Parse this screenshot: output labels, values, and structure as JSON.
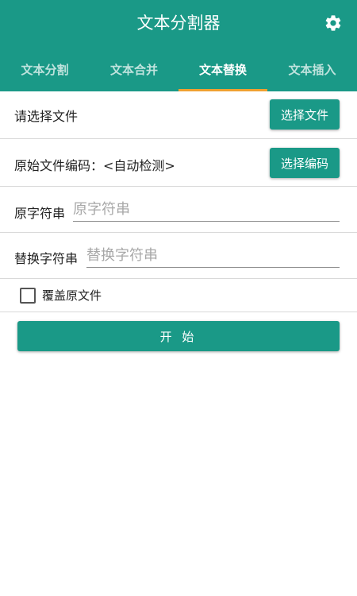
{
  "app": {
    "title": "文本分割器",
    "accent": "#1a9987",
    "tab_indicator": "#f0a030"
  },
  "header": {
    "settings_icon": "gear-icon"
  },
  "tabs": [
    {
      "label": "文本分割"
    },
    {
      "label": "文本合并"
    },
    {
      "label": "文本替换",
      "active": true
    },
    {
      "label": "文本插入"
    }
  ],
  "file_row": {
    "label": "请选择文件",
    "button": "选择文件"
  },
  "encoding_row": {
    "label": "原始文件编码：<自动检测>",
    "button": "选择编码"
  },
  "source_row": {
    "label": "原字符串",
    "placeholder": "原字符串",
    "value": ""
  },
  "replace_row": {
    "label": "替换字符串",
    "placeholder": "替换字符串",
    "value": ""
  },
  "overwrite": {
    "label": "覆盖原文件",
    "checked": false
  },
  "start_button": "开 始"
}
